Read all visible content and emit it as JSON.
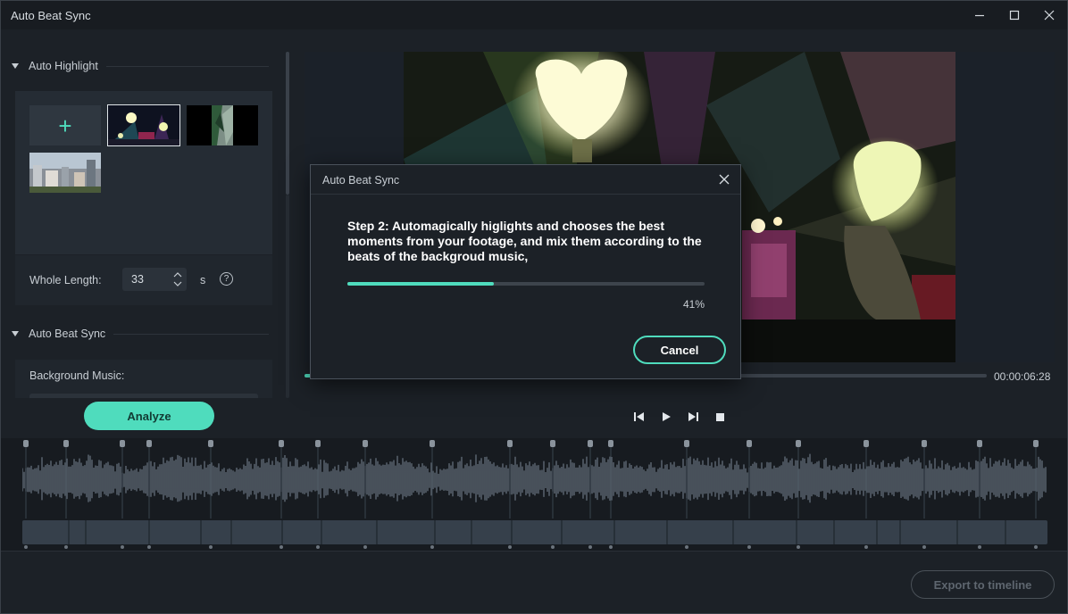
{
  "window": {
    "title": "Auto Beat Sync"
  },
  "left_panel": {
    "auto_highlight": {
      "heading": "Auto Highlight",
      "add_symbol": "+",
      "thumbnails": [
        "concert-lightsticks",
        "palm-trees-split",
        "city-buildings"
      ],
      "whole_length_label": "Whole Length:",
      "whole_length_value": "33",
      "whole_length_unit": "s",
      "help_symbol": "?"
    },
    "auto_beat_sync": {
      "heading": "Auto Beat Sync",
      "background_music_label": "Background Music:"
    },
    "analyze_label": "Analyze"
  },
  "preview": {
    "timecode": "00:00:06:28",
    "playback_progress": 0.01
  },
  "timeline": {
    "export_label": "Export to timeline"
  },
  "dialog": {
    "title": "Auto Beat Sync",
    "message": "Step 2: Automagically higlights and chooses the best moments from your footage, and mix them according to the beats of the backgroud music,",
    "progress_percent": 41,
    "progress_text": "41%",
    "cancel_label": "Cancel"
  },
  "colors": {
    "accent": "#4fdcbd",
    "background": "#1c2127",
    "panel": "#252c34"
  }
}
